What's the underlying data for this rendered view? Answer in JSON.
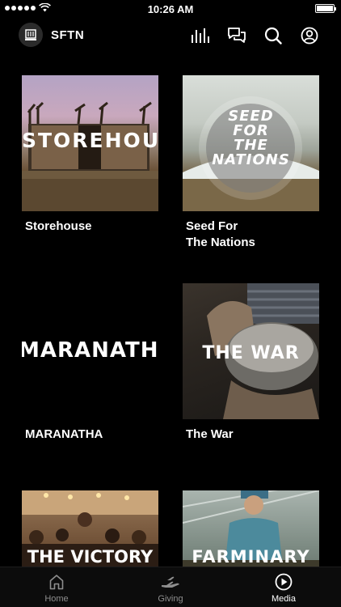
{
  "status_bar": {
    "time": "10:26 AM"
  },
  "header": {
    "brand": "SFTN"
  },
  "media": {
    "items": [
      {
        "label": "Storehouse",
        "thumb_title": "STOREHOUSE"
      },
      {
        "label": "Seed For\nThe Nations",
        "thumb_title_1": "SEED",
        "thumb_title_2": "FOR",
        "thumb_title_3": "THE",
        "thumb_title_4": "NATIONS"
      },
      {
        "label": "MARANATHA",
        "thumb_title": "MARANATHA"
      },
      {
        "label": "The War",
        "thumb_title": "THE WAR"
      },
      {
        "label": "",
        "thumb_title": "THE VICTORY"
      },
      {
        "label": "",
        "thumb_title": "FARMINARY"
      }
    ]
  },
  "tabs": [
    {
      "label": "Home",
      "icon": "home-icon",
      "active": false
    },
    {
      "label": "Giving",
      "icon": "giving-icon",
      "active": false
    },
    {
      "label": "Media",
      "icon": "play-circle-icon",
      "active": true
    }
  ],
  "colors": {
    "accent": "#ffffff",
    "background": "#000000",
    "inactive": "#8e8e8e"
  }
}
